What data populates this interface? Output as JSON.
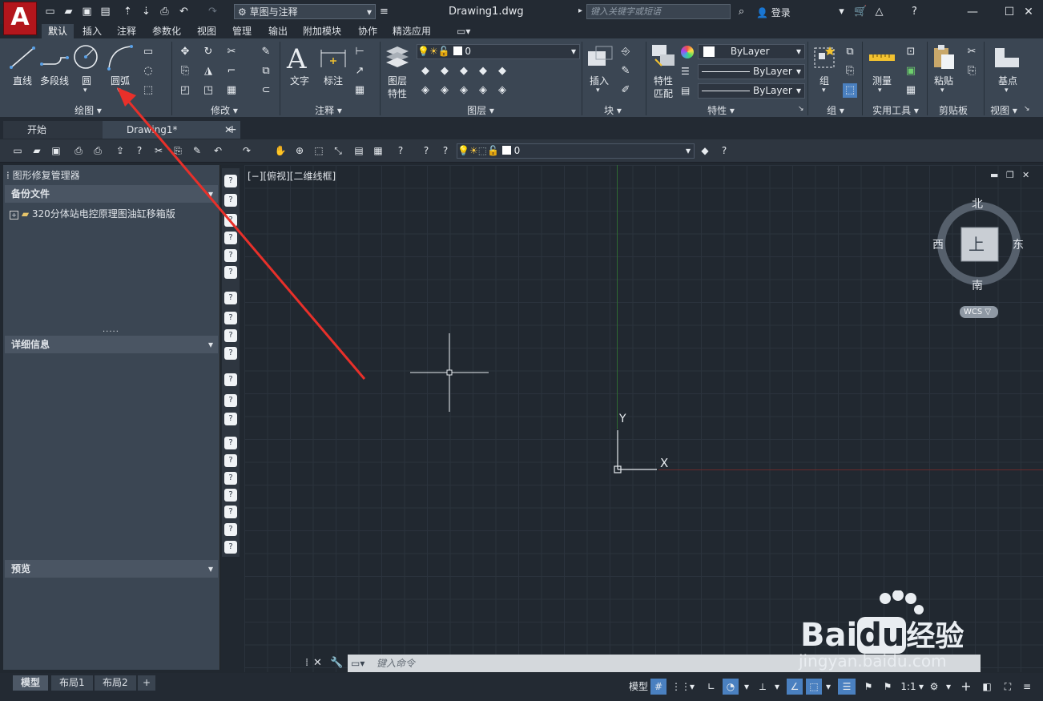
{
  "app": {
    "logo_letter": "A",
    "workspace": "草图与注释",
    "document_title": "Drawing1.dwg",
    "search_placeholder": "键入关键字或短语",
    "login_label": "登录"
  },
  "ribbon": {
    "tabs": [
      "默认",
      "插入",
      "注释",
      "参数化",
      "视图",
      "管理",
      "输出",
      "附加模块",
      "协作",
      "精选应用"
    ],
    "active_tab": "默认",
    "draw": {
      "title": "绘图",
      "line": "直线",
      "polyline": "多段线",
      "circle": "圆",
      "arc": "圆弧"
    },
    "modify": {
      "title": "修改"
    },
    "annotation": {
      "title": "注释",
      "text": "文字",
      "dimension": "标注"
    },
    "layers": {
      "title": "图层",
      "layer_properties": "图层\n特性",
      "layer_props_l1": "图层",
      "layer_props_l2": "特性",
      "current_layer": "0"
    },
    "block": {
      "title": "块",
      "insert": "插入"
    },
    "properties": {
      "title": "特性",
      "match_l1": "特性",
      "match_l2": "匹配",
      "color": "ByLayer",
      "linetype": "ByLayer",
      "lineweight": "ByLayer"
    },
    "groups": {
      "title": "组",
      "group": "组"
    },
    "utilities": {
      "title": "实用工具",
      "measure": "测量"
    },
    "clipboard": {
      "title": "剪贴板",
      "paste": "粘贴"
    },
    "view": {
      "title": "视图",
      "base": "基点"
    }
  },
  "file_tabs": {
    "start": "开始",
    "drawing": "Drawing1*",
    "add": "+"
  },
  "toolbar": {
    "layer_value": "0"
  },
  "palette": {
    "title": "图形修复管理器",
    "backup_header": "备份文件",
    "backup_item": "320分体站电控原理图油缸移箱版",
    "details_header": "详细信息",
    "preview_header": "预览"
  },
  "canvas": {
    "view_label": "[−][俯视][二维线框]",
    "y_axis": "Y",
    "x_axis": "X",
    "compass": {
      "north": "北",
      "south": "南",
      "east": "东",
      "west": "西",
      "top": "上",
      "wcs": "WCS"
    },
    "command_placeholder": "键入命令"
  },
  "status": {
    "layout_tabs": [
      "模型",
      "布局1",
      "布局2"
    ],
    "active_layout": "模型",
    "add_layout": "+",
    "model_label": "模型",
    "scale": "1:1"
  },
  "watermark": {
    "brand": "Bai",
    "brand_du": "du",
    "cn": "经验",
    "url": "jingyan.baidu.com"
  },
  "colors": {
    "arrow": "#e8302a",
    "accent": "#4a80c0",
    "logo": "#b3161c"
  }
}
